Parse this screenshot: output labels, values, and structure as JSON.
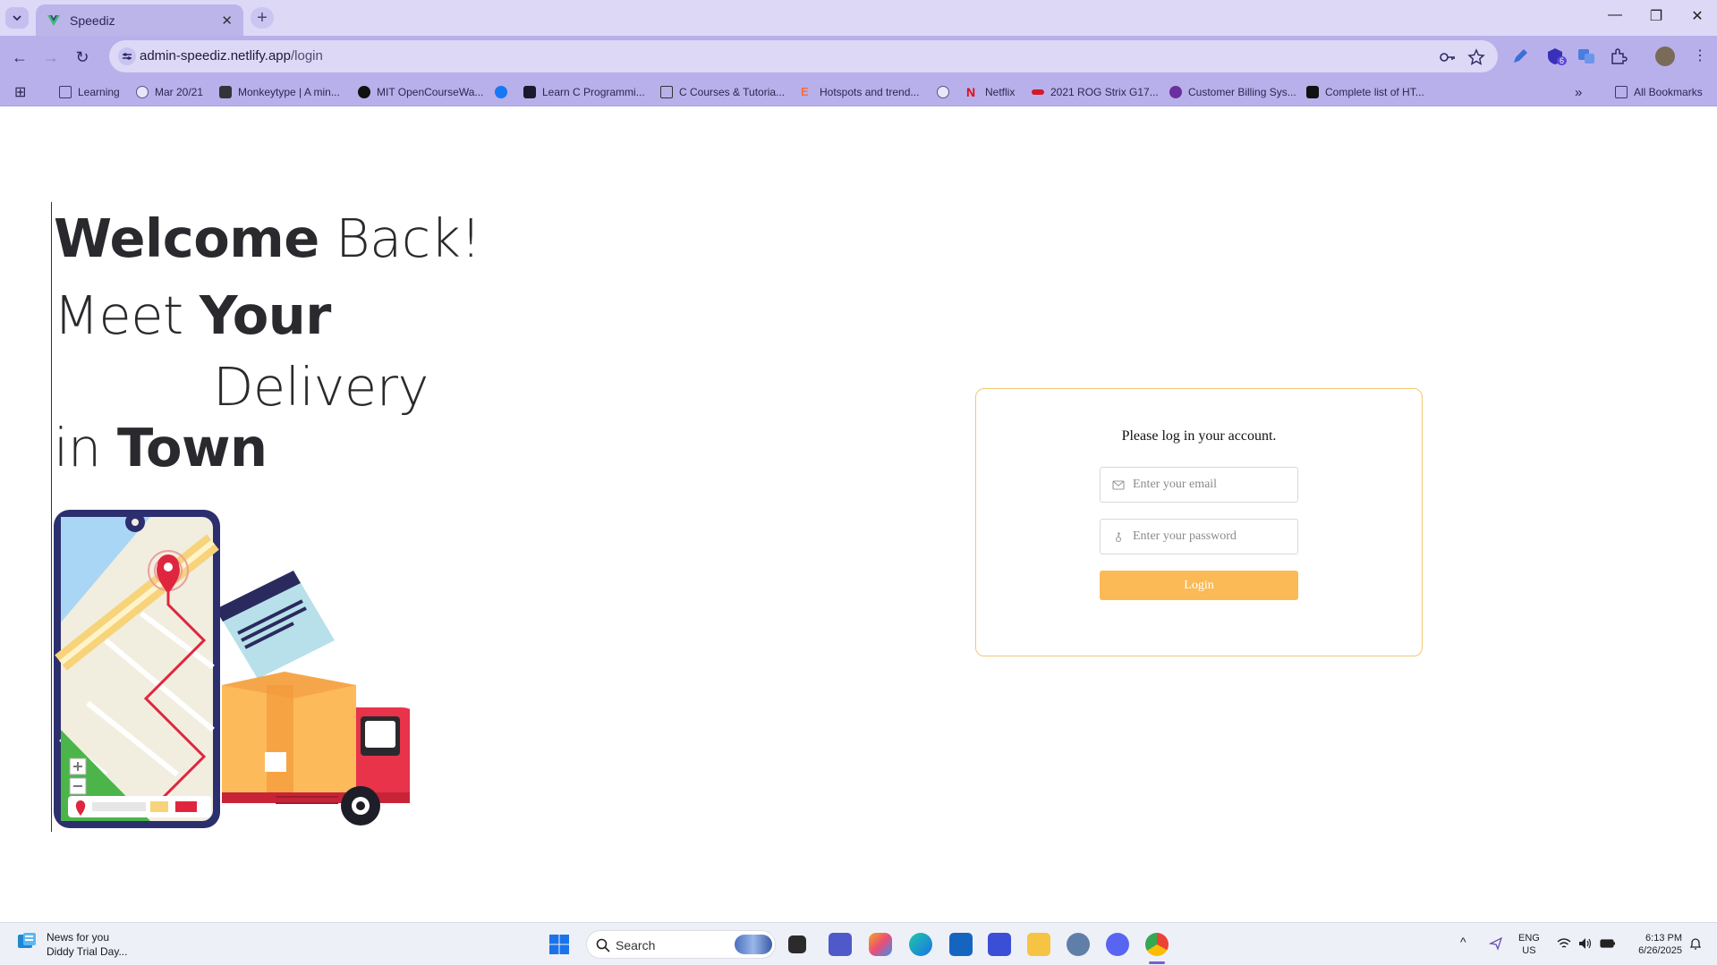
{
  "browser": {
    "tab_title": "Speediz",
    "url_host": "admin-speediz.netlify.app",
    "url_path": "/login",
    "bookmarks": [
      "Learning",
      "Mar 20/21",
      "Monkeytype | A min...",
      "MIT OpenCourseWa...",
      "",
      "Learn C Programmi...",
      "C Courses & Tutoria...",
      "Hotspots and trend...",
      "",
      "Netflix",
      "2021 ROG Strix G17...",
      "Customer Billing Sys...",
      "Complete list of HT..."
    ],
    "all_bookmarks": "All Bookmarks",
    "extension_badge": "6"
  },
  "hero": {
    "line1_bold": "Welcome",
    "line1_light": " Back!",
    "line2_light": "Meet ",
    "line2_bold": "Your",
    "line3_light": "Delivery",
    "line4_light": "in ",
    "line4_bold": "Town"
  },
  "login": {
    "title": "Please log in your account.",
    "email_placeholder": "Enter your email",
    "password_placeholder": "Enter your password",
    "button_label": "Login",
    "accent_color": "#fbba55"
  },
  "taskbar": {
    "news_title": "News for you",
    "news_subtitle": "Diddy Trial Day...",
    "search_label": "Search",
    "lang": "ENG",
    "region": "US",
    "time": "6:13 PM",
    "date": "6/26/2025"
  }
}
